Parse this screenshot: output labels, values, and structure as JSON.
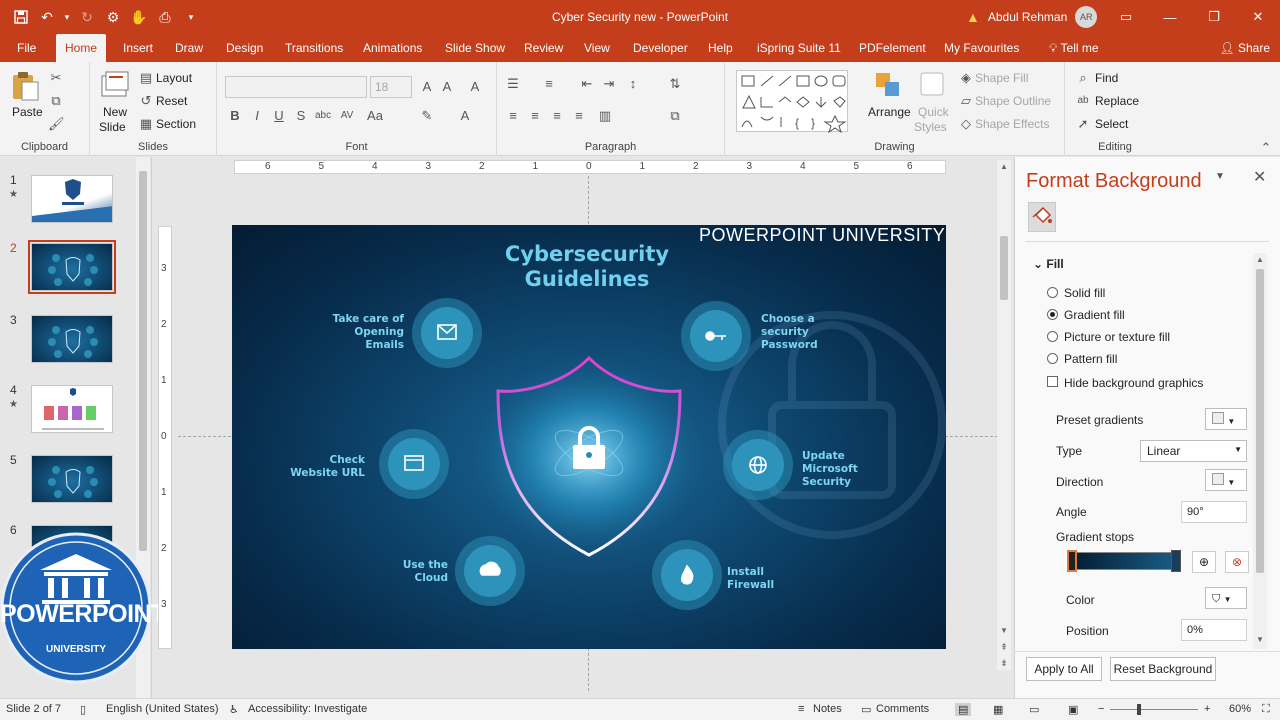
{
  "window": {
    "title": "Cyber Security new  -  PowerPoint",
    "user_name": "Abdul Rehman",
    "user_initials": "AR"
  },
  "ribbon_tabs": [
    "File",
    "Home",
    "Insert",
    "Draw",
    "Design",
    "Transitions",
    "Animations",
    "Slide Show",
    "Review",
    "View",
    "Developer",
    "Help",
    "iSpring Suite 11",
    "PDFelement",
    "My Favourites",
    "Tell me"
  ],
  "share_label": "Share",
  "ribbon": {
    "clipboard": {
      "paste": "Paste",
      "label": "Clipboard"
    },
    "slides": {
      "new_slide_1": "New",
      "new_slide_2": "Slide",
      "layout": "Layout",
      "reset": "Reset",
      "section": "Section",
      "label": "Slides"
    },
    "font": {
      "size": "18",
      "label": "Font"
    },
    "paragraph": {
      "label": "Paragraph"
    },
    "drawing": {
      "arrange": "Arrange",
      "quick_styles_1": "Quick",
      "quick_styles_2": "Styles",
      "shape_fill": "Shape Fill",
      "shape_outline": "Shape Outline",
      "shape_effects": "Shape Effects",
      "label": "Drawing"
    },
    "editing": {
      "find": "Find",
      "replace": "Replace",
      "select": "Select",
      "label": "Editing"
    }
  },
  "thumbnails": [
    {
      "num": "1",
      "star": true
    },
    {
      "num": "2",
      "star": false
    },
    {
      "num": "3",
      "star": false
    },
    {
      "num": "4",
      "star": true
    },
    {
      "num": "5",
      "star": false
    },
    {
      "num": "6",
      "star": false
    }
  ],
  "slide": {
    "title_line1": "Cybersecurity",
    "title_line2": "Guidelines",
    "brand": "POWERPOINT UNIVERSITY",
    "items": [
      {
        "l1": "Take care of",
        "l2": "Opening",
        "l3": "Emails"
      },
      {
        "l1": "Choose a",
        "l2": "security",
        "l3": "Password"
      },
      {
        "l1": "Check",
        "l2": "Website URL"
      },
      {
        "l1": "Update",
        "l2": "Microsoft",
        "l3": "Security"
      },
      {
        "l1": "Use the",
        "l2": "Cloud"
      },
      {
        "l1": "Install",
        "l2": "Firewall"
      }
    ]
  },
  "rulers": {
    "h": [
      "6",
      "5",
      "4",
      "3",
      "2",
      "1",
      "0",
      "1",
      "2",
      "3",
      "4",
      "5",
      "6"
    ],
    "v": [
      "3",
      "2",
      "1",
      "0",
      "1",
      "2",
      "3"
    ]
  },
  "format_pane": {
    "title": "Format Background",
    "section": "Fill",
    "options": [
      "Solid fill",
      "Gradient fill",
      "Picture or texture fill",
      "Pattern fill"
    ],
    "selected_option": "Gradient fill",
    "hide_bg": "Hide background graphics",
    "preset_gradients": "Preset gradients",
    "type_label": "Type",
    "type_value": "Linear",
    "direction_label": "Direction",
    "angle_label": "Angle",
    "angle_value": "90°",
    "gradient_stops": "Gradient stops",
    "color_label": "Color",
    "position_label": "Position",
    "position_value": "0%",
    "apply_all": "Apply to All",
    "reset_bg": "Reset Background"
  },
  "watermark": {
    "line1": "POWERPOINT",
    "line2": "UNIVERSITY"
  },
  "status": {
    "slide": "Slide 2 of 7",
    "language": "English (United States)",
    "accessibility": "Accessibility: Investigate",
    "notes": "Notes",
    "comments": "Comments",
    "zoom": "60%"
  },
  "colors": {
    "accent": "#c43e1c",
    "slide_text": "#7fd6f2",
    "circle": "#2a8db4"
  },
  "icons": [
    "save-icon",
    "undo-icon",
    "redo-icon",
    "search-icon",
    "close-icon",
    "warning-icon",
    "paint-bucket-icon",
    "lock-icon"
  ]
}
